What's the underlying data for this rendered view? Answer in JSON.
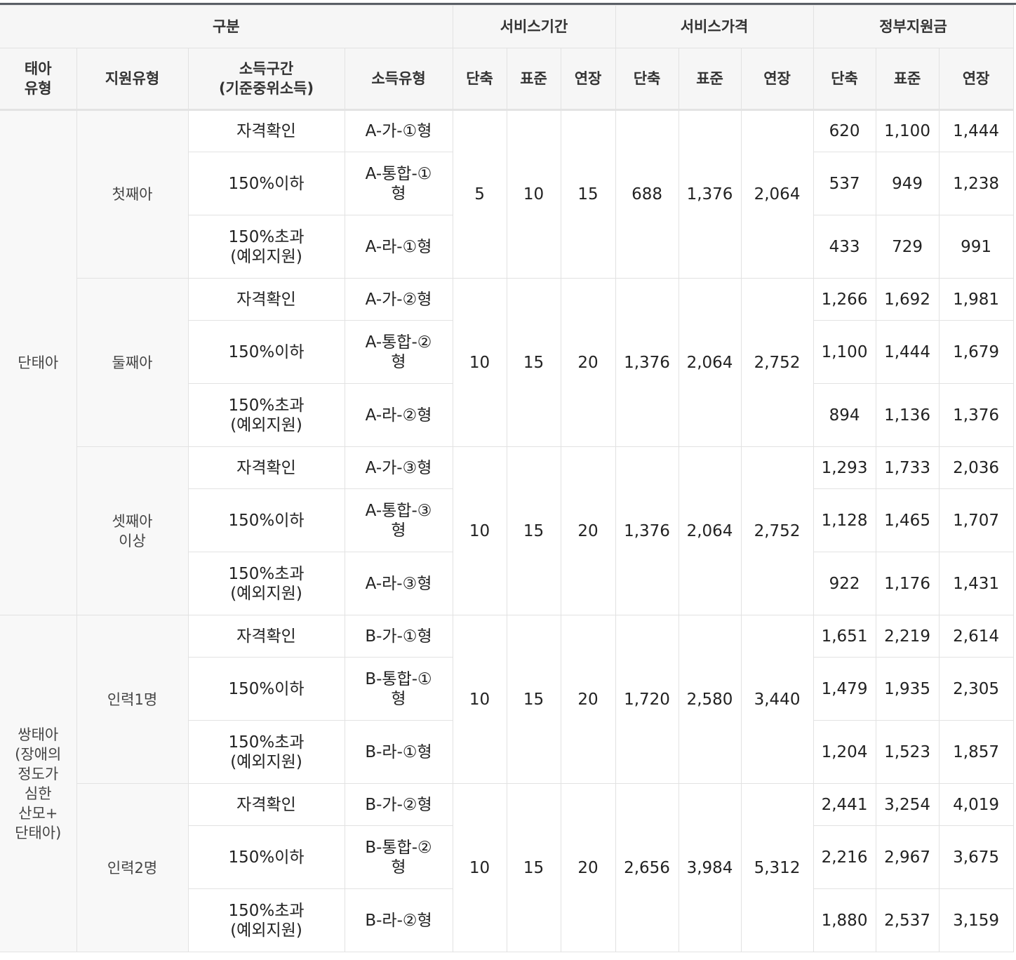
{
  "header": {
    "group": "구분",
    "service_period": "서비스기간",
    "service_price": "서비스가격",
    "gov_support": "정부지원금",
    "fetus_type": "태아\n유형",
    "support_type": "지원유형",
    "income_range": "소득구간\n(기준중위소득)",
    "income_type": "소득유형",
    "short": "단축",
    "standard": "표준",
    "extended": "연장"
  },
  "fetus_types": [
    "단태아",
    "쌍태아\n(장애의\n정도가\n심한\n산모+\n단태아)"
  ],
  "groups": [
    {
      "support_type": "첫째아",
      "period": [
        "5",
        "10",
        "15"
      ],
      "price": [
        "688",
        "1,376",
        "2,064"
      ],
      "rows": [
        {
          "income": "자격확인",
          "type": "A-가-①형",
          "gov": [
            "620",
            "1,100",
            "1,444"
          ]
        },
        {
          "income": "150%이하",
          "type": "A-통합-①\n형",
          "gov": [
            "537",
            "949",
            "1,238"
          ]
        },
        {
          "income": "150%초과\n(예외지원)",
          "type": "A-라-①형",
          "gov": [
            "433",
            "729",
            "991"
          ]
        }
      ]
    },
    {
      "support_type": "둘째아",
      "period": [
        "10",
        "15",
        "20"
      ],
      "price": [
        "1,376",
        "2,064",
        "2,752"
      ],
      "rows": [
        {
          "income": "자격확인",
          "type": "A-가-②형",
          "gov": [
            "1,266",
            "1,692",
            "1,981"
          ]
        },
        {
          "income": "150%이하",
          "type": "A-통합-②\n형",
          "gov": [
            "1,100",
            "1,444",
            "1,679"
          ]
        },
        {
          "income": "150%초과\n(예외지원)",
          "type": "A-라-②형",
          "gov": [
            "894",
            "1,136",
            "1,376"
          ]
        }
      ]
    },
    {
      "support_type": "셋째아\n이상",
      "period": [
        "10",
        "15",
        "20"
      ],
      "price": [
        "1,376",
        "2,064",
        "2,752"
      ],
      "rows": [
        {
          "income": "자격확인",
          "type": "A-가-③형",
          "gov": [
            "1,293",
            "1,733",
            "2,036"
          ]
        },
        {
          "income": "150%이하",
          "type": "A-통합-③\n형",
          "gov": [
            "1,128",
            "1,465",
            "1,707"
          ]
        },
        {
          "income": "150%초과\n(예외지원)",
          "type": "A-라-③형",
          "gov": [
            "922",
            "1,176",
            "1,431"
          ]
        }
      ]
    },
    {
      "support_type": "인력1명",
      "period": [
        "10",
        "15",
        "20"
      ],
      "price": [
        "1,720",
        "2,580",
        "3,440"
      ],
      "rows": [
        {
          "income": "자격확인",
          "type": "B-가-①형",
          "gov": [
            "1,651",
            "2,219",
            "2,614"
          ]
        },
        {
          "income": "150%이하",
          "type": "B-통합-①\n형",
          "gov": [
            "1,479",
            "1,935",
            "2,305"
          ]
        },
        {
          "income": "150%초과\n(예외지원)",
          "type": "B-라-①형",
          "gov": [
            "1,204",
            "1,523",
            "1,857"
          ]
        }
      ]
    },
    {
      "support_type": "인력2명",
      "period": [
        "10",
        "15",
        "20"
      ],
      "price": [
        "2,656",
        "3,984",
        "5,312"
      ],
      "rows": [
        {
          "income": "자격확인",
          "type": "B-가-②형",
          "gov": [
            "2,441",
            "3,254",
            "4,019"
          ]
        },
        {
          "income": "150%이하",
          "type": "B-통합-②\n형",
          "gov": [
            "2,216",
            "2,967",
            "3,675"
          ]
        },
        {
          "income": "150%초과\n(예외지원)",
          "type": "B-라-②형",
          "gov": [
            "1,880",
            "2,537",
            "3,159"
          ]
        }
      ]
    }
  ]
}
